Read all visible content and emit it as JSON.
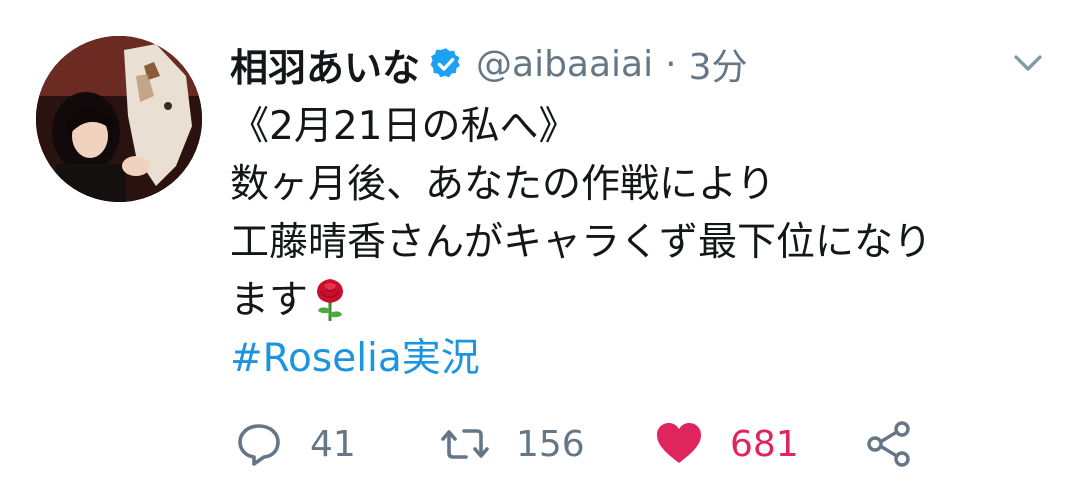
{
  "user": {
    "display_name": "相羽あいな",
    "handle": "@aibaaiai",
    "separator": "·",
    "time": "3分",
    "verified_icon": "verified-badge-icon"
  },
  "tweet": {
    "lines": [
      "《2月21日の私へ》",
      "数ヶ月後、あなたの作戦により",
      "工藤晴香さんがキャラくず最下位になり",
      "ます"
    ],
    "emoji": "rose-emoji",
    "hashtag": "#Roselia実況"
  },
  "actions": {
    "reply_count": "41",
    "retweet_count": "156",
    "like_count": "681",
    "liked": true
  },
  "colors": {
    "text": "#14171a",
    "muted": "#657786",
    "link": "#1b95e0",
    "like": "#e0245e",
    "verified": "#1da1f2"
  }
}
